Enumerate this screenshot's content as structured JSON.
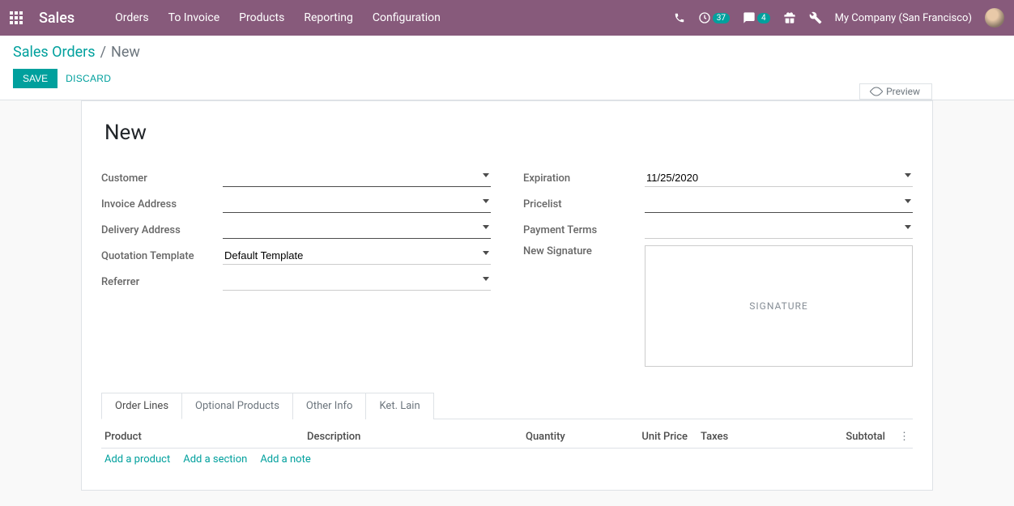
{
  "navbar": {
    "brand": "Sales",
    "menu": [
      "Orders",
      "To Invoice",
      "Products",
      "Reporting",
      "Configuration"
    ],
    "activity_badge": "37",
    "message_badge": "4",
    "company": "My Company (San Francisco)"
  },
  "breadcrumb": {
    "parent": "Sales Orders",
    "current": "New"
  },
  "buttons": {
    "save": "SAVE",
    "discard": "DISCARD"
  },
  "preview_label": "Preview",
  "form": {
    "title": "New",
    "left": {
      "customer": {
        "label": "Customer",
        "value": ""
      },
      "invoice_address": {
        "label": "Invoice Address",
        "value": ""
      },
      "delivery_address": {
        "label": "Delivery Address",
        "value": ""
      },
      "quotation_template": {
        "label": "Quotation Template",
        "value": "Default Template"
      },
      "referrer": {
        "label": "Referrer",
        "value": ""
      }
    },
    "right": {
      "expiration": {
        "label": "Expiration",
        "value": "11/25/2020"
      },
      "pricelist": {
        "label": "Pricelist",
        "value": ""
      },
      "payment_terms": {
        "label": "Payment Terms",
        "value": ""
      },
      "signature": {
        "label": "New Signature",
        "placeholder": "SIGNATURE"
      }
    }
  },
  "tabs": [
    "Order Lines",
    "Optional Products",
    "Other Info",
    "Ket. Lain"
  ],
  "table": {
    "headers": {
      "product": "Product",
      "description": "Description",
      "quantity": "Quantity",
      "unit_price": "Unit Price",
      "taxes": "Taxes",
      "subtotal": "Subtotal"
    },
    "add": {
      "product": "Add a product",
      "section": "Add a section",
      "note": "Add a note"
    }
  }
}
